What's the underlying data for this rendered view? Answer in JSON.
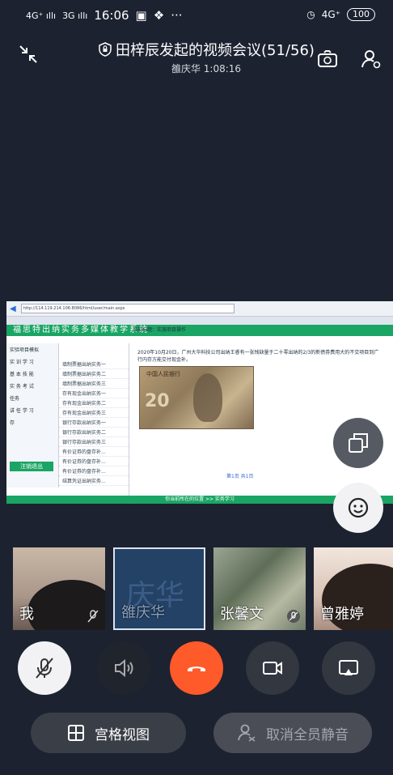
{
  "status_bar": {
    "signal_1": "4G⁺ ıllı",
    "signal_2": "3G ıllı",
    "time": "16:06",
    "ellipsis": "···",
    "net_speed": "4G⁺",
    "battery": "100"
  },
  "header": {
    "title": "田梓辰发起的视频会议(51/56)",
    "subtitle": "雒庆华 1:08:16"
  },
  "shared_screen": {
    "url": "http://114.119.214.106:8086/html/user/main.aspx",
    "site_title": "福思特出纳实务多媒体教学系统",
    "breadcrumb": "当前标题：实施项目操作",
    "side_items": [
      "实验项目模拟",
      "实 训 学 习",
      "基 本 技 能",
      "实 务 考 试",
      "任务",
      "讲 任 学 习",
      "存"
    ],
    "exit_label": "注销退出",
    "list_items": [
      "填制票据出纳实务一",
      "填制票据出纳实务二",
      "填制票据出纳实务三",
      "存有现金出纳实务一",
      "存有现金出纳实务二",
      "存有现金出纳实务三",
      "银行存款出纳实务一",
      "银行存款出纳实务二",
      "银行存款出纳实务三",
      "有价证券的盘存补...",
      "有价证券的盘存补...",
      "有价证券的盘存补...",
      "结算凭证出纳实务..."
    ],
    "paragraph": "2020年10月20日，广州大华科技公司出纳王睿有一张残缺量于二十零出纳的2/3的新债券费用大的不交项目到广行内存方能交付现金补。",
    "banknote_text": "中国人民银行",
    "pager": "第1页 共1页",
    "footer": "你当前所在的位置 >> 实务学习"
  },
  "participants": [
    {
      "name": "我",
      "label": "我"
    },
    {
      "name": "雒庆华",
      "avatar_text": "庆华"
    },
    {
      "name": "张馨文"
    },
    {
      "name": "曾雅婷"
    }
  ],
  "bottom_buttons": {
    "grid_view": "宫格视图",
    "unmute_all": "取消全员静音"
  },
  "colors": {
    "background": "#1c2230",
    "end_call": "#ff5a2a",
    "site_green": "#1aa564"
  }
}
